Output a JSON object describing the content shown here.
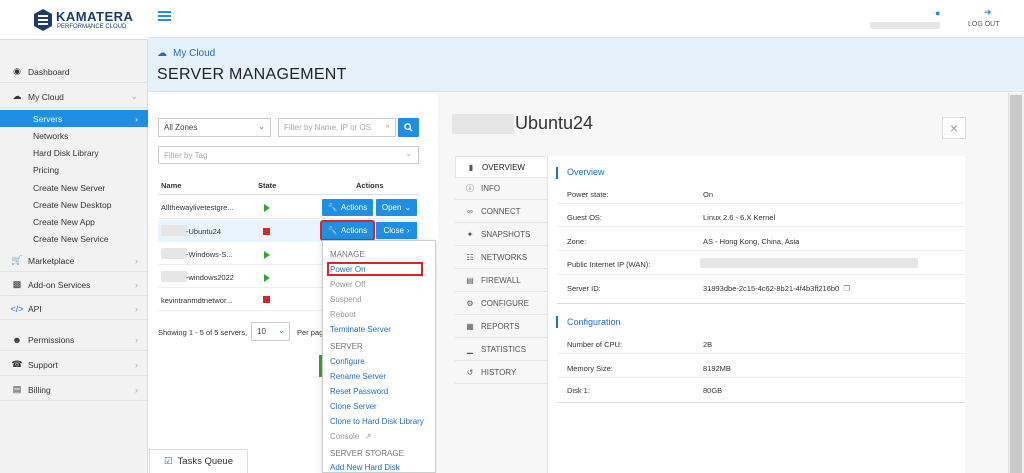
{
  "brand": {
    "name": "KAMATERA",
    "tagline": "PERFORMANCE CLOUD"
  },
  "header": {
    "logout": "LOG OUT"
  },
  "sidebar": {
    "items": [
      {
        "icon": "dashboard-icon",
        "label": "Dashboard"
      },
      {
        "icon": "cloud-icon",
        "label": "My Cloud"
      },
      {
        "icon": "cart-icon",
        "label": "Marketplace"
      },
      {
        "icon": "puzzle-icon",
        "label": "Add-on Services"
      },
      {
        "icon": "code-icon",
        "label": "API"
      },
      {
        "icon": "users-icon",
        "label": "Permissions"
      },
      {
        "icon": "headset-icon",
        "label": "Support"
      },
      {
        "icon": "card-icon",
        "label": "Billing"
      }
    ],
    "subitems": [
      "Servers",
      "Networks",
      "Hard Disk Library",
      "Pricing",
      "Create New Server",
      "Create New Desktop",
      "Create New App",
      "Create New Service"
    ]
  },
  "breadcrumb": {
    "parent": "My Cloud",
    "title": "SERVER MANAGEMENT"
  },
  "filters": {
    "zone": "All Zones",
    "search_placeholder": "Filter by Name, IP or OS",
    "tag_placeholder": "Filter by Tag"
  },
  "table": {
    "headers": [
      "Name",
      "State",
      "Actions"
    ],
    "rows": [
      {
        "name": "Allthewaylivetestgre...",
        "state": "on",
        "action": "Actions",
        "toggle": "Open"
      },
      {
        "name": "-Ubuntu24",
        "state": "off",
        "action": "Actions",
        "toggle": "Close"
      },
      {
        "name": "-Windows-S...",
        "state": "on"
      },
      {
        "name": "-windows2022",
        "state": "on"
      },
      {
        "name": "kevintranmdtnetwor...",
        "state": "off"
      }
    ],
    "footer": "Showing 1 - 5 of 5 servers,",
    "per_page": "10",
    "per_page_label": "Per page"
  },
  "dropdown": {
    "manage_head": "MANAGE",
    "manage": [
      "Power On",
      "Power Off",
      "Suspend",
      "Reboot",
      "Terminate Server"
    ],
    "server_head": "SERVER",
    "server": [
      "Configure",
      "Rename Server",
      "Reset Password",
      "Clone Server",
      "Clone to Hard Disk Library",
      "Console"
    ],
    "storage_head": "SERVER STORAGE",
    "storage": [
      "Add New Hard Disk"
    ]
  },
  "tasks_queue": "Tasks Queue",
  "detail": {
    "server_name": "Ubuntu24",
    "tabs": [
      "OVERVIEW",
      "INFO",
      "CONNECT",
      "SNAPSHOTS",
      "NETWORKS",
      "FIREWALL",
      "CONFIGURE",
      "REPORTS",
      "STATISTICS",
      "HISTORY"
    ],
    "overview_title": "Overview",
    "overview": [
      {
        "label": "Power state:",
        "value": "On"
      },
      {
        "label": "Guest OS:",
        "value": "Linux 2.6 - 6.X Kernel"
      },
      {
        "label": "Zone:",
        "value": "AS - Hong Kong, China, Asia"
      },
      {
        "label": "Public Internet IP (WAN):",
        "value": ""
      },
      {
        "label": "Server ID:",
        "value": "31993dbe-2c15-4c62-8b21-4f4b3ff216b0"
      }
    ],
    "config_title": "Configuration",
    "config": [
      {
        "label": "Number of CPU:",
        "value": "2B"
      },
      {
        "label": "Memory Size:",
        "value": "8192MB"
      },
      {
        "label": "Disk 1:",
        "value": "80GB"
      }
    ]
  },
  "colors": {
    "accent": "#1f8fe3",
    "highlight": "#d62626",
    "running": "#2eab2e"
  }
}
